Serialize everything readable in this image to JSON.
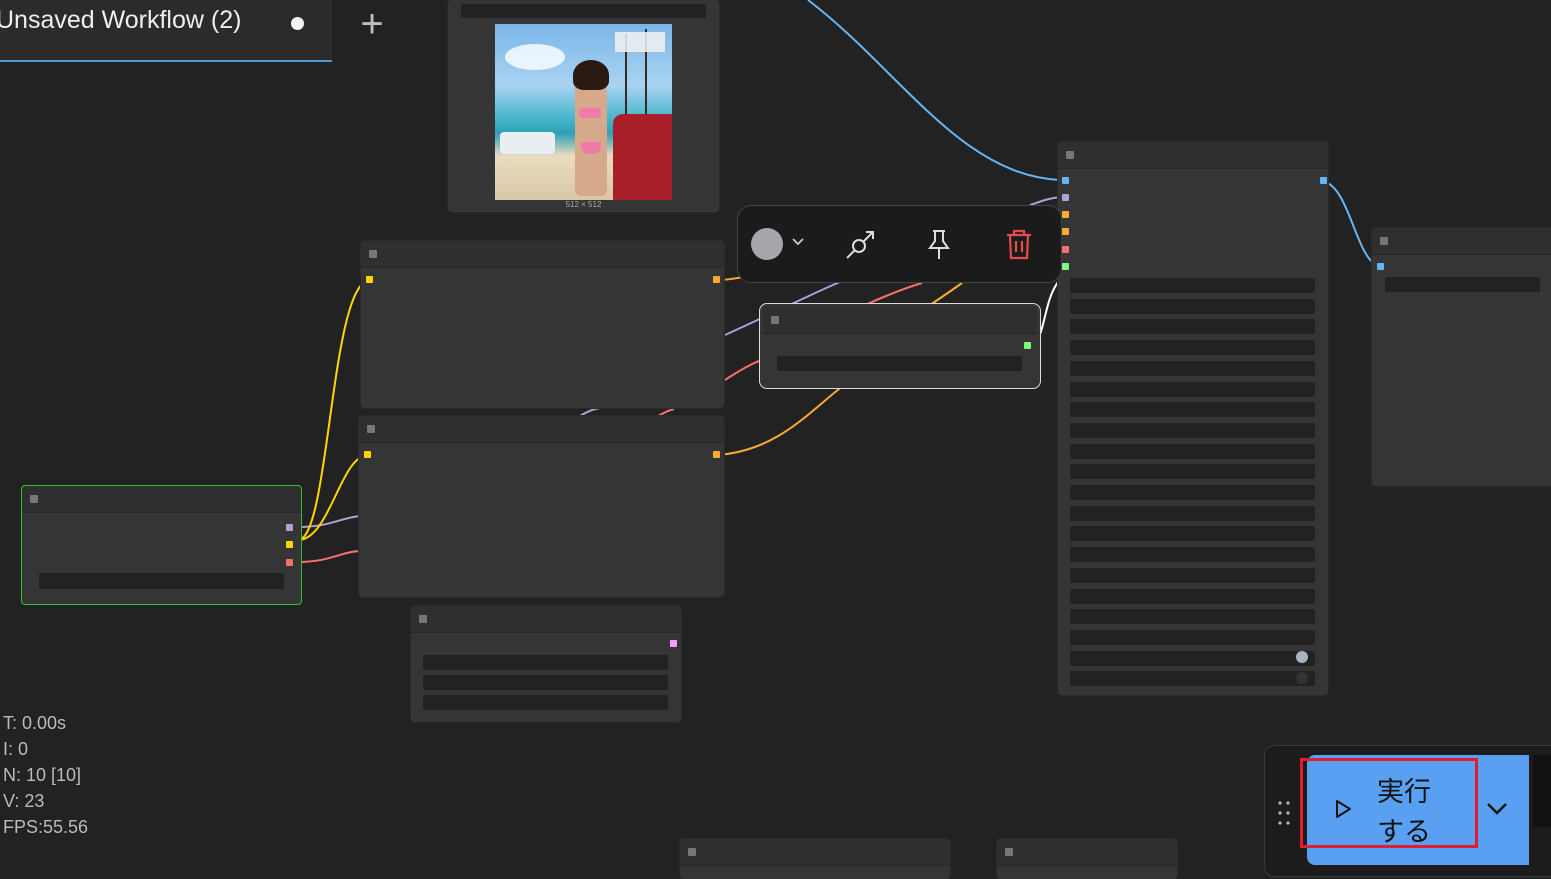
{
  "tab": {
    "title": "Unsaved Workflow (2)",
    "unsaved_marker": "●",
    "new_tab_icon": "plus-icon"
  },
  "preview": {
    "size_label": "512 × 512"
  },
  "toolbox": {
    "color_swatch": "#a6a6ad",
    "icons": [
      "color-picker-icon",
      "chevron-down-icon",
      "bypass-icon",
      "pin-icon",
      "trash-icon"
    ],
    "delete_color": "#e74c4c"
  },
  "stats": {
    "time": "T: 0.00s",
    "iterations": "I: 0",
    "nodes": "N: 10 [10]",
    "vertices": "V: 23",
    "fps": "FPS:55.56"
  },
  "run": {
    "label": "実行する",
    "play_icon": "play-icon",
    "menu_icon": "chevron-down-icon",
    "drag_icon": "drag-handle-icon",
    "accent": "#5aa0f2",
    "highlight": "#e01e2f"
  },
  "link_colors": {
    "model": "#b39ddb",
    "clip": "#ffd500",
    "vae": "#ff6e6e",
    "conditioning": "#ffa931",
    "latent": "#ff9cf9",
    "image": "#64b5f6",
    "white": "#ffffff",
    "green": "#7cfc7c"
  }
}
